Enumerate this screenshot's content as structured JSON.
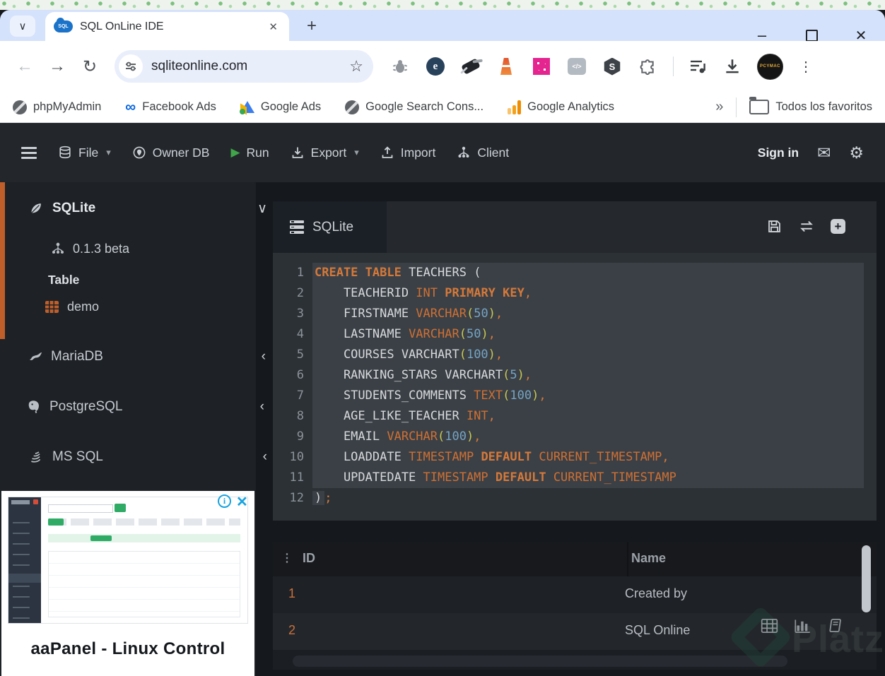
{
  "glyphs": {
    "chevron_down": "∨",
    "chevron_left": "‹",
    "close": "✕",
    "plus": "+",
    "minimize": "–",
    "back": "←",
    "forward": "→",
    "reload": "↻",
    "star": "☆",
    "overflow": "»",
    "menu_dots": "⋮",
    "drag_dots": "⋮",
    "envelope": "✉",
    "gear": "⚙",
    "caret_down": "▾",
    "play": "▶",
    "meta_logo": "∞",
    "code_tag": "</>",
    "letter_e": "e",
    "letter_s": "S",
    "info": "i"
  },
  "browser": {
    "tab_title": "SQL OnLine IDE",
    "favicon_text": "SQL",
    "url": "sqliteonline.com",
    "avatar_text": "PCYMAC",
    "bookmarks": [
      {
        "label": "phpMyAdmin",
        "icon": "globe"
      },
      {
        "label": "Facebook Ads",
        "icon": "meta"
      },
      {
        "label": "Google Ads",
        "icon": "google-ads"
      },
      {
        "label": "Google Search Cons...",
        "icon": "globe"
      },
      {
        "label": "Google Analytics",
        "icon": "google-analytics"
      }
    ],
    "favorites_folder_label": "Todos los favoritos"
  },
  "app_toolbar": {
    "file": "File",
    "owner_db": "Owner DB",
    "run": "Run",
    "export": "Export",
    "import": "Import",
    "client": "Client",
    "sign_in": "Sign in"
  },
  "sidebar": {
    "sqlite_label": "SQLite",
    "version": "0.1.3 beta",
    "section_table": "Table",
    "table_name": "demo",
    "engines": [
      {
        "label": "MariaDB"
      },
      {
        "label": "PostgreSQL"
      },
      {
        "label": "MS SQL"
      }
    ]
  },
  "ad": {
    "title": "aaPanel - Linux Control"
  },
  "editor": {
    "tab_label": "SQLite",
    "lines": [
      {
        "hl": true,
        "t": [
          [
            "kw",
            "CREATE"
          ],
          [
            "id",
            " "
          ],
          [
            "kw",
            "TABLE"
          ],
          [
            "id",
            " TEACHERS ("
          ]
        ]
      },
      {
        "hl": true,
        "t": [
          [
            "id",
            "    TEACHERID "
          ],
          [
            "kw2",
            "INT"
          ],
          [
            "id",
            " "
          ],
          [
            "kw",
            "PRIMARY KEY"
          ],
          [
            "pun",
            ","
          ]
        ]
      },
      {
        "hl": true,
        "t": [
          [
            "id",
            "    FIRSTNAME "
          ],
          [
            "kw2",
            "VARCHAR"
          ],
          [
            "brk",
            "("
          ],
          [
            "num",
            "50"
          ],
          [
            "brk",
            ")"
          ],
          [
            "pun",
            ","
          ]
        ]
      },
      {
        "hl": true,
        "t": [
          [
            "id",
            "    LASTNAME "
          ],
          [
            "kw2",
            "VARCHAR"
          ],
          [
            "brk",
            "("
          ],
          [
            "num",
            "50"
          ],
          [
            "brk",
            ")"
          ],
          [
            "pun",
            ","
          ]
        ]
      },
      {
        "hl": true,
        "t": [
          [
            "id",
            "    COURSES VARCHART"
          ],
          [
            "brk",
            "("
          ],
          [
            "num",
            "100"
          ],
          [
            "brk",
            ")"
          ],
          [
            "pun",
            ","
          ]
        ]
      },
      {
        "hl": true,
        "t": [
          [
            "id",
            "    RANKING_STARS VARCHART"
          ],
          [
            "brk",
            "("
          ],
          [
            "num",
            "5"
          ],
          [
            "brk",
            ")"
          ],
          [
            "pun",
            ","
          ]
        ]
      },
      {
        "hl": true,
        "t": [
          [
            "id",
            "    STUDENTS_COMMENTS "
          ],
          [
            "kw2",
            "TEXT"
          ],
          [
            "brk",
            "("
          ],
          [
            "num",
            "100"
          ],
          [
            "brk",
            ")"
          ],
          [
            "pun",
            ","
          ]
        ]
      },
      {
        "hl": true,
        "t": [
          [
            "id",
            "    AGE_LIKE_TEACHER "
          ],
          [
            "kw2",
            "INT"
          ],
          [
            "pun",
            ","
          ]
        ]
      },
      {
        "hl": true,
        "t": [
          [
            "id",
            "    EMAIL "
          ],
          [
            "kw2",
            "VARCHAR"
          ],
          [
            "brk",
            "("
          ],
          [
            "num",
            "100"
          ],
          [
            "brk",
            ")"
          ],
          [
            "pun",
            ","
          ]
        ]
      },
      {
        "hl": true,
        "t": [
          [
            "id",
            "    LOADDATE "
          ],
          [
            "kw2",
            "TIMESTAMP"
          ],
          [
            "id",
            " "
          ],
          [
            "kw",
            "DEFAULT"
          ],
          [
            "id",
            " "
          ],
          [
            "kw2",
            "CURRENT_TIMESTAMP"
          ],
          [
            "pun",
            ","
          ]
        ]
      },
      {
        "hl": true,
        "t": [
          [
            "id",
            "    UPDATEDATE "
          ],
          [
            "kw2",
            "TIMESTAMP"
          ],
          [
            "id",
            " "
          ],
          [
            "kw",
            "DEFAULT"
          ],
          [
            "id",
            " "
          ],
          [
            "kw2",
            "CURRENT_TIMESTAMP"
          ]
        ]
      },
      {
        "hl": false,
        "t": [
          [
            "idh",
            ")"
          ],
          [
            "pun",
            ";"
          ]
        ]
      }
    ]
  },
  "results": {
    "columns": {
      "id": "ID",
      "name": "Name"
    },
    "rows": [
      {
        "id": "1",
        "name": "Created by"
      },
      {
        "id": "2",
        "name": "SQL Online"
      }
    ]
  },
  "watermark": {
    "text": "Platzi"
  },
  "colors": {
    "accent_orange": "#c05f2a",
    "run_green": "#3fa548",
    "keyword_orange": "#d5793a",
    "number_blue": "#76a4c4",
    "bracket_yellow": "#c8c952",
    "identifier": "#d7dadd",
    "statement_highlight": "#3b4046",
    "tabbar_blue": "#d5e2fb",
    "appbar_dark": "#23272c",
    "sidebar_dark": "#1e2227",
    "editor_dark": "#2c3136"
  }
}
